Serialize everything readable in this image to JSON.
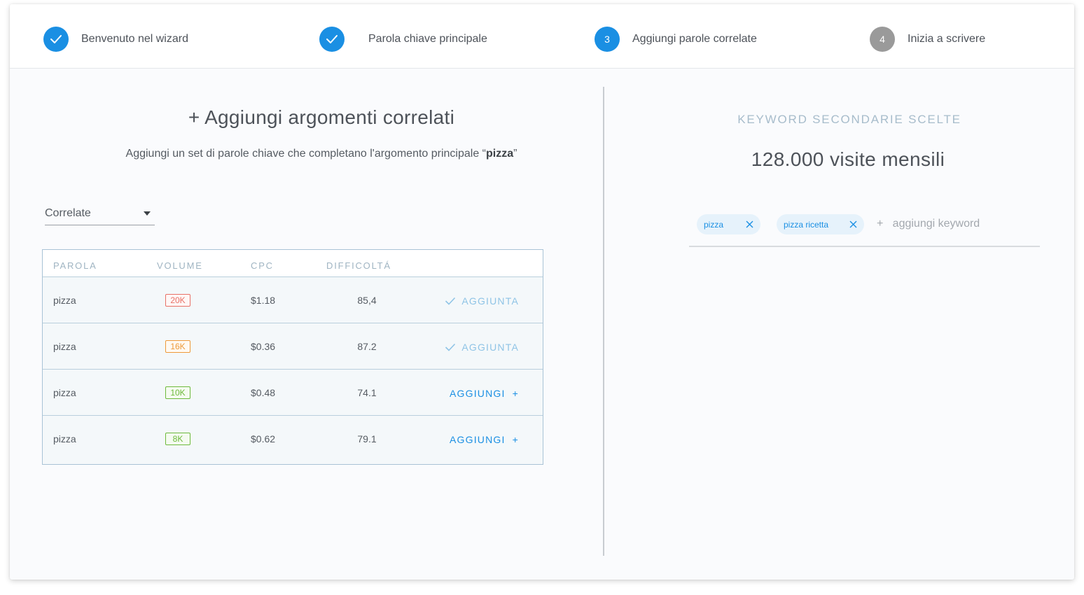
{
  "stepper": {
    "steps": [
      {
        "label": "Benvenuto nel wizard",
        "state": "done",
        "icon": "check-icon"
      },
      {
        "label": "Parola chiave principale",
        "state": "done",
        "icon": "check-icon"
      },
      {
        "label": "Aggiungi parole correlate",
        "state": "current",
        "number": "3"
      },
      {
        "label": "Inizia a scrivere",
        "state": "pending",
        "number": "4"
      }
    ]
  },
  "left": {
    "title": "+ Aggiungi argomenti correlati",
    "subtitle_prefix": "Aggiungi un set di parole chiave che completano l'argomento principale “",
    "subtitle_keyword": "pizza",
    "subtitle_suffix": "”",
    "filter": {
      "selected": "Correlate"
    },
    "table": {
      "columns": [
        "Parola",
        "Volume",
        "CPC",
        "Difficoltá",
        ""
      ],
      "rows": [
        {
          "word": "pizza",
          "volume": "20K",
          "volume_color": "#e87167",
          "cpc": "$1.18",
          "difficulty": "85,4",
          "action": "AGGIUNTA",
          "added": true
        },
        {
          "word": "pizza",
          "volume": "16K",
          "volume_color": "#ee9a3a",
          "cpc": "$0.36",
          "difficulty": "87.2",
          "action": "AGGIUNTA",
          "added": true
        },
        {
          "word": "pizza",
          "volume": "10K",
          "volume_color": "#6dba3b",
          "cpc": "$0.48",
          "difficulty": "74.1",
          "action": "AGGIUNGI",
          "added": false
        },
        {
          "word": "pizza",
          "volume": "8K",
          "volume_color": "#6dba3b",
          "cpc": "$0.62",
          "difficulty": "79.1",
          "action": "AGGIUNGI",
          "added": false
        }
      ]
    }
  },
  "right": {
    "caption": "KEYWORD SECONDARIE SCELTE",
    "total": "128.000 visite mensili",
    "tags": [
      "pizza",
      "pizza ricetta"
    ],
    "add_placeholder": "+   aggiungi keyword"
  },
  "colors": {
    "accent": "#1a8fe3",
    "pending": "#9a9a9a",
    "added": "#8fc4e6"
  }
}
